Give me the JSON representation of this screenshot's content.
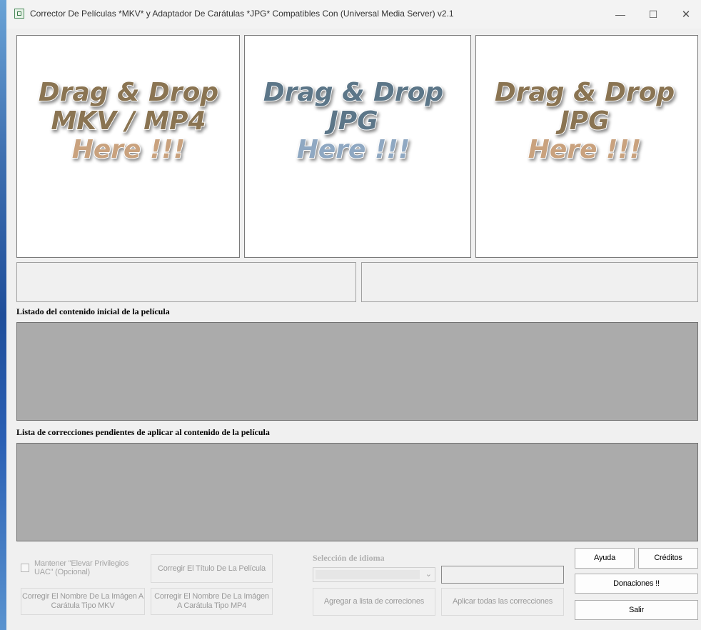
{
  "window": {
    "title": "Corrector De Películas *MKV* y Adaptador De Carátulas *JPG* Compatibles Con (Universal Media Server) v2.1",
    "minimize_glyph": "—",
    "maximize_glyph": "☐",
    "close_glyph": "✕"
  },
  "drop_panels": [
    {
      "line1": "Drag & Drop",
      "line2": "MKV / MP4",
      "line3": "Here !!!",
      "line12_color": "#8a7452",
      "line3_color": "#c9a27e"
    },
    {
      "line1": "Drag & Drop",
      "line2": "JPG",
      "line3": "Here !!!",
      "line12_color": "#5c7688",
      "line3_color": "#8fa8c2"
    },
    {
      "line1": "Drag & Drop",
      "line2": "JPG",
      "line3": "Here !!!",
      "line12_color": "#8a7452",
      "line3_color": "#c9a27e"
    }
  ],
  "sections": {
    "initial_list_label": "Listado del contenido inicial de la película",
    "pending_list_label": "Lista de correcciones pendientes de aplicar al contenido de la película"
  },
  "controls": {
    "uac_checkbox_label": "Mantener \"Elevar Privilegios UAC\" (Opcional)",
    "fix_title_button": "Corregir El Título De La Película",
    "fix_mkv_image_button": "Corregir El Nombre De La Imágen A Carátula Tipo MKV",
    "fix_mp4_image_button": "Corregir El Nombre De La Imágen A Carátula Tipo MP4",
    "language_label": "Selección de idioma",
    "language_selected": "",
    "language_text": "",
    "add_to_list_button": "Agregar a lista de correciones",
    "apply_all_button": "Aplicar todas las correcciones",
    "help_button": "Ayuda",
    "credits_button": "Créditos",
    "donations_button": "Donaciones !!",
    "exit_button": "Salir"
  },
  "icons": [
    "app-icon",
    "chevron-down-icon"
  ]
}
